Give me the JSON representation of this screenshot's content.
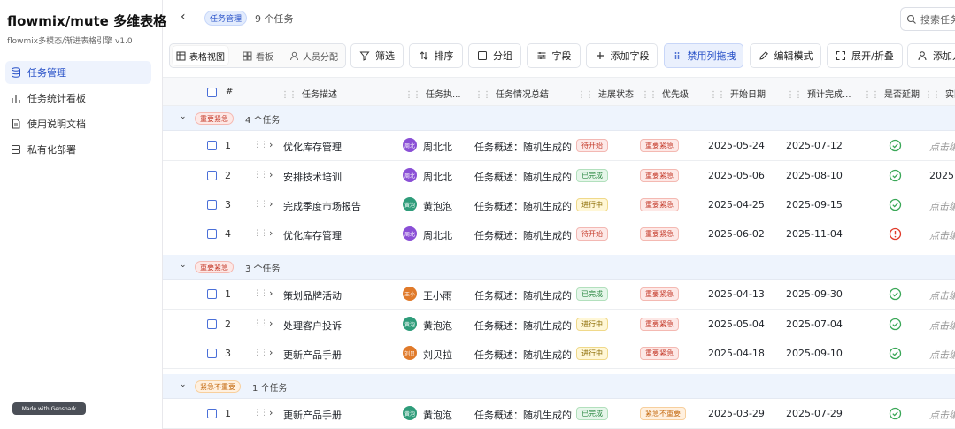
{
  "sidebar": {
    "brand": "flowmix/mute 多维表格",
    "version": "flowmix多模态/渐进表格引擎 v1.0",
    "items": [
      {
        "label": "任务管理",
        "icon": "database-icon",
        "active": true
      },
      {
        "label": "任务统计看板",
        "icon": "bar-chart-icon",
        "active": false
      },
      {
        "label": "使用说明文档",
        "icon": "document-icon",
        "active": false
      },
      {
        "label": "私有化部署",
        "icon": "server-icon",
        "active": false
      }
    ],
    "made_badge": "Made with Genspark"
  },
  "header": {
    "title_tag": "任务管理",
    "task_count": "9 个任务",
    "search_placeholder": "搜索任务"
  },
  "toolbar": {
    "views": {
      "table": "表格视图",
      "kanban": "看板",
      "people": "人员分配"
    },
    "filter": "筛选",
    "sort": "排序",
    "group": "分组",
    "fields": "字段",
    "add_field": "添加字段",
    "disable_drag": "禁用列拖拽",
    "edit_mode": "编辑模式",
    "expand_collapse": "展开/折叠",
    "add_person": "添加人"
  },
  "columns": {
    "num": "#",
    "desc": "任务描述",
    "owner": "任务执...",
    "summary": "任务情况总结",
    "status": "进展状态",
    "priority": "优先级",
    "start": "开始日期",
    "due": "预计完成...",
    "delayed": "是否延期",
    "actual": "实际"
  },
  "groups": [
    {
      "badge": "重要紧急",
      "badge_color": "#c43a2a",
      "count": "4 个任务",
      "rows": [
        {
          "num": "1",
          "desc": "优化库存管理",
          "avatar": "周北",
          "avatar_color": "#8a4fd6",
          "owner": "周北北",
          "summary": "任务概述：随机生成的",
          "status": "待开始",
          "status_kind": "todo",
          "priority": "重要紧急",
          "priority_kind": "red",
          "start": "2025-05-24",
          "due": "2025-07-12",
          "delayed": "ok",
          "actual": "点击编"
        },
        {
          "num": "2",
          "desc": "安排技术培训",
          "avatar": "周北",
          "avatar_color": "#8a4fd6",
          "owner": "周北北",
          "summary": "任务概述：随机生成的",
          "status": "已完成",
          "status_kind": "done",
          "priority": "重要紧急",
          "priority_kind": "red",
          "start": "2025-05-06",
          "due": "2025-08-10",
          "delayed": "ok",
          "actual": "2025"
        },
        {
          "num": "3",
          "desc": "完成季度市场报告",
          "avatar": "黄泡",
          "avatar_color": "#2f9c7a",
          "owner": "黄泡泡",
          "summary": "任务概述：随机生成的",
          "status": "进行中",
          "status_kind": "prog",
          "priority": "重要紧急",
          "priority_kind": "red",
          "start": "2025-04-25",
          "due": "2025-09-15",
          "delayed": "ok",
          "actual": "点击编"
        },
        {
          "num": "4",
          "desc": "优化库存管理",
          "avatar": "周北",
          "avatar_color": "#8a4fd6",
          "owner": "周北北",
          "summary": "任务概述：随机生成的",
          "status": "待开始",
          "status_kind": "todo",
          "priority": "重要紧急",
          "priority_kind": "red",
          "start": "2025-06-02",
          "due": "2025-11-04",
          "delayed": "late",
          "actual": "点击编"
        }
      ]
    },
    {
      "badge": "重要紧急",
      "badge_color": "#c43a2a",
      "count": "3 个任务",
      "rows": [
        {
          "num": "1",
          "desc": "策划品牌活动",
          "avatar": "王小",
          "avatar_color": "#e07a2a",
          "owner": "王小雨",
          "summary": "任务概述：随机生成的",
          "status": "已完成",
          "status_kind": "done",
          "priority": "重要紧急",
          "priority_kind": "red",
          "start": "2025-04-13",
          "due": "2025-09-30",
          "delayed": "ok",
          "actual": "点击编"
        },
        {
          "num": "2",
          "desc": "处理客户投诉",
          "avatar": "黄泡",
          "avatar_color": "#2f9c7a",
          "owner": "黄泡泡",
          "summary": "任务概述：随机生成的",
          "status": "进行中",
          "status_kind": "prog",
          "priority": "重要紧急",
          "priority_kind": "red",
          "start": "2025-05-04",
          "due": "2025-07-04",
          "delayed": "ok",
          "actual": "点击编"
        },
        {
          "num": "3",
          "desc": "更新产品手册",
          "avatar": "刘贝",
          "avatar_color": "#e07a2a",
          "owner": "刘贝拉",
          "summary": "任务概述：随机生成的",
          "status": "进行中",
          "status_kind": "prog",
          "priority": "重要紧急",
          "priority_kind": "red",
          "start": "2025-04-18",
          "due": "2025-09-10",
          "delayed": "ok",
          "actual": "点击编"
        }
      ]
    },
    {
      "badge": "紧急不重要",
      "badge_color": "#c46a10",
      "count": "1 个任务",
      "rows": [
        {
          "num": "1",
          "desc": "更新产品手册",
          "avatar": "黄泡",
          "avatar_color": "#2f9c7a",
          "owner": "黄泡泡",
          "summary": "任务概述：随机生成的",
          "status": "已完成",
          "status_kind": "done",
          "priority": "紧急不重要",
          "priority_kind": "orange",
          "start": "2025-03-29",
          "due": "2025-07-29",
          "delayed": "ok",
          "actual": "点击编"
        }
      ]
    }
  ]
}
